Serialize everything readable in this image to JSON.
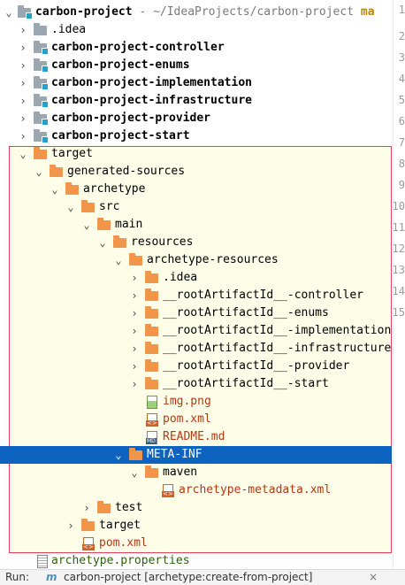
{
  "root": {
    "name": "carbon-project",
    "path": "~/IdeaProjects/carbon-project",
    "truncated": "ma"
  },
  "tree": [
    {
      "label": ".idea",
      "arrow": "›"
    },
    {
      "label": "carbon-project-controller",
      "arrow": "›"
    },
    {
      "label": "carbon-project-enums",
      "arrow": "›"
    },
    {
      "label": "carbon-project-implementation",
      "arrow": "›"
    },
    {
      "label": "carbon-project-infrastructure",
      "arrow": "›"
    },
    {
      "label": "carbon-project-provider",
      "arrow": "›"
    },
    {
      "label": "carbon-project-start",
      "arrow": "›"
    },
    {
      "label": "target",
      "arrow": "⌄"
    },
    {
      "label": "generated-sources",
      "arrow": "⌄"
    },
    {
      "label": "archetype",
      "arrow": "⌄"
    },
    {
      "label": "src",
      "arrow": "⌄"
    },
    {
      "label": "main",
      "arrow": "⌄"
    },
    {
      "label": "resources",
      "arrow": "⌄"
    },
    {
      "label": "archetype-resources",
      "arrow": "⌄"
    },
    {
      "label": ".idea",
      "arrow": "›"
    },
    {
      "label": "__rootArtifactId__-controller",
      "arrow": "›"
    },
    {
      "label": "__rootArtifactId__-enums",
      "arrow": "›"
    },
    {
      "label": "__rootArtifactId__-implementation",
      "arrow": "›"
    },
    {
      "label": "__rootArtifactId__-infrastructure",
      "arrow": "›"
    },
    {
      "label": "__rootArtifactId__-provider",
      "arrow": "›"
    },
    {
      "label": "__rootArtifactId__-start",
      "arrow": "›"
    },
    {
      "label": "img.png"
    },
    {
      "label": "pom.xml"
    },
    {
      "label": "README.md"
    },
    {
      "label": "META-INF",
      "arrow": "⌄"
    },
    {
      "label": "maven",
      "arrow": "⌄"
    },
    {
      "label": "archetype-metadata.xml"
    },
    {
      "label": "test",
      "arrow": "›"
    },
    {
      "label": "target",
      "arrow": "›"
    },
    {
      "label": "pom.xml"
    },
    {
      "label": "archetype.properties"
    }
  ],
  "gutter_lines": [
    "1",
    "2",
    "3",
    "4",
    "5",
    "6",
    "7",
    "8",
    "9",
    "10",
    "11",
    "12",
    "13",
    "14",
    "15"
  ],
  "run_bar": {
    "label": "Run:",
    "icon": "m",
    "text": "carbon-project [archetype:create-from-project]",
    "close": "×"
  },
  "colors": {
    "selection": "#0e63c0",
    "folder": "#f0954a",
    "module_folder": "#9aa7b0",
    "highlight_border": "#e0405a",
    "highlight_bg": "#fefde8"
  }
}
